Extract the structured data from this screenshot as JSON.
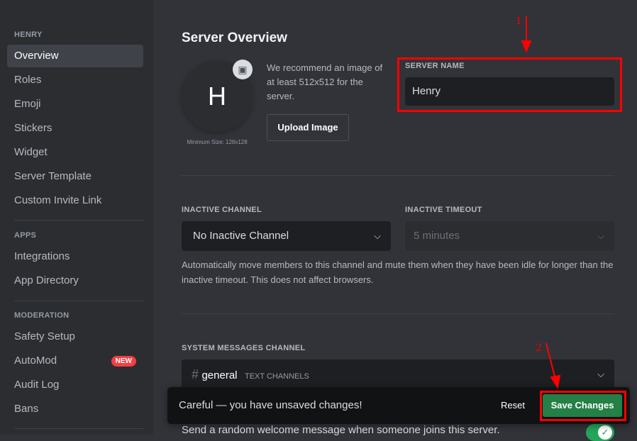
{
  "sidebar": {
    "sections": [
      {
        "header": "HENRY"
      },
      {
        "header": "APPS"
      },
      {
        "header": "MODERATION"
      }
    ],
    "items": [
      "Overview",
      "Roles",
      "Emoji",
      "Stickers",
      "Widget",
      "Server Template",
      "Custom Invite Link",
      "Integrations",
      "App Directory",
      "Safety Setup",
      "AutoMod",
      "Audit Log",
      "Bans"
    ],
    "automod_badge": "NEW",
    "selected": "Overview"
  },
  "main": {
    "title": "Server Overview",
    "icon_letter": "H",
    "min_size": "Minimum Size: 128x128",
    "recommend": "We recommend an image of at least 512x512 for the server.",
    "upload_label": "Upload Image",
    "server_name_label": "SERVER NAME",
    "server_name_value": "Henry",
    "inactive_channel_label": "INACTIVE CHANNEL",
    "inactive_channel_value": "No Inactive Channel",
    "inactive_timeout_label": "INACTIVE TIMEOUT",
    "inactive_timeout_value": "5 minutes",
    "inactive_help": "Automatically move members to this channel and mute them when they have been idle for longer than the inactive timeout. This does not affect browsers.",
    "system_label": "SYSTEM MESSAGES CHANNEL",
    "system_channel": "general",
    "system_category": "TEXT CHANNELS",
    "welcome_text": "Send a random welcome message when someone joins this server.",
    "welcome_enabled": true
  },
  "unsaved": {
    "message": "Careful — you have unsaved changes!",
    "reset": "Reset",
    "save": "Save Changes"
  },
  "annotations": {
    "step1": "1",
    "step2": "2",
    "color": "#ff0000"
  }
}
